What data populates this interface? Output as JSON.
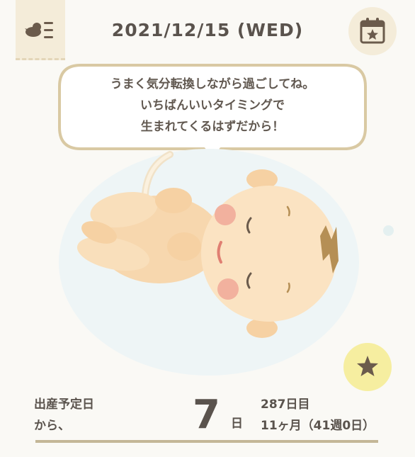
{
  "header": {
    "date": "2021/12/15 (WED)",
    "menu_icon": "bird-list-icon",
    "calendar_icon": "calendar-star-icon"
  },
  "speech": {
    "lines": [
      "うまく気分転換しながら過ごしてね。",
      "いちばんいいタイミングで",
      "生まれてくるはずだから！"
    ]
  },
  "counter": {
    "label_line1": "出産予定日",
    "label_line2": "から、",
    "value": "7",
    "unit": "日",
    "day_count": "287日目",
    "month_week": "11ヶ月（41週0日）"
  },
  "favorite": {
    "icon": "star-icon"
  },
  "colors": {
    "background": "#faf9f5",
    "tab": "#f4ecd9",
    "bubble_border": "#d9c9a3",
    "star_button": "#f6eea0",
    "text": "#5a534d",
    "rule": "#c4b797"
  }
}
